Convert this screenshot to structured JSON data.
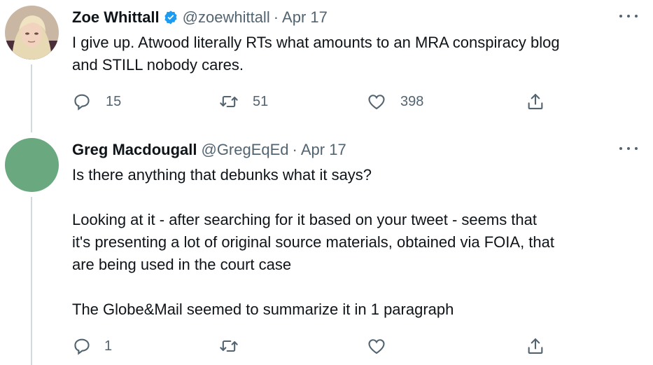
{
  "tweets": [
    {
      "name": "Zoe Whittall",
      "handle": "@zoewhittall",
      "separator": "·",
      "date": "Apr 17",
      "verified": true,
      "avatar_icon": "profile-photo",
      "text": [
        "I give up. Atwood literally RTs what amounts to an MRA conspiracy blog",
        "and STILL nobody cares."
      ],
      "replies": "15",
      "retweets": "51",
      "likes": "398"
    },
    {
      "name": "Greg Macdougall",
      "handle": "@GregEqEd",
      "separator": "·",
      "date": "Apr 17",
      "verified": false,
      "avatar_color": "#6aa87f",
      "paragraphs": [
        [
          "Is there anything that debunks what it says?"
        ],
        [
          "Looking at it - after searching for it based on your tweet - seems that",
          "it's presenting a lot of original source materials, obtained via FOIA, that",
          "are being used in the court case"
        ],
        [
          "The Globe&Mail seemed to summarize it in 1 paragraph"
        ]
      ],
      "replies": "1",
      "retweets": "",
      "likes": ""
    }
  ],
  "colors": {
    "text": "#0f1419",
    "secondary": "#536471",
    "verified_blue": "#1d9bf0",
    "thread_line": "#cfd9de"
  },
  "icons": [
    "reply-icon",
    "retweet-icon",
    "like-icon",
    "share-icon",
    "more-icon",
    "verified-badge-icon"
  ]
}
